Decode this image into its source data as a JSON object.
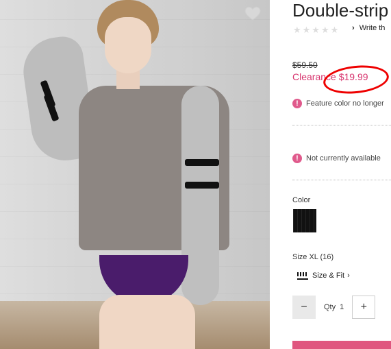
{
  "product": {
    "title": "Double-strip",
    "review_link": "Write th",
    "price_original": "$59.50",
    "price_clearance": "Clearance $19.99",
    "notice_color": "Feature color no longer",
    "notice_availability": "Not currently available",
    "color_label": "Color",
    "size_label": "Size XL (16)",
    "size_fit": "Size & Fit",
    "qty_label": "Qty",
    "qty_value": "1"
  },
  "icons": {
    "heart": "heart-icon",
    "review_chevron": "chevron-right-icon",
    "size_fit_chevron": "chevron-right-icon",
    "alert": "alert-icon",
    "ruler": "ruler-icon",
    "minus": "minus-icon",
    "plus": "plus-icon"
  },
  "colors": {
    "accent_pink": "#d7336d",
    "annotation_red": "#e00000",
    "swatch_black": "#111111"
  }
}
